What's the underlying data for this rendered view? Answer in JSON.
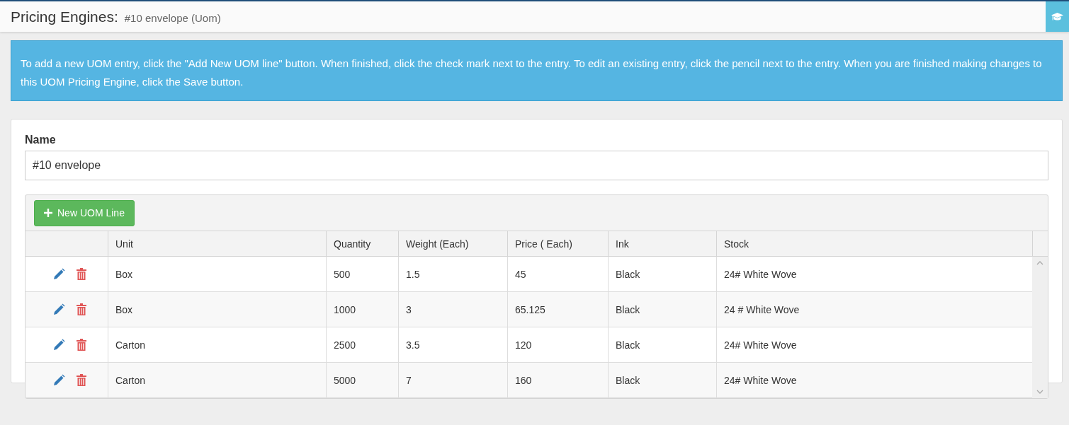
{
  "header": {
    "title": "Pricing Engines:",
    "subtitle": "#10 envelope (Uom)"
  },
  "info": "To add a new UOM entry, click the \"Add New UOM line\" button. When finished, click the check mark next to the entry. To edit an existing entry, click the pencil next to the entry. When you are finished making changes to this UOM Pricing Engine, click the Save button.",
  "form": {
    "name_label": "Name",
    "name_value": "#10 envelope"
  },
  "toolbar": {
    "add_button": "New UOM Line"
  },
  "table": {
    "columns": [
      "Unit",
      "Quantity",
      "Weight (Each)",
      "Price ( Each)",
      "Ink",
      "Stock"
    ],
    "rows": [
      {
        "cells": [
          "Box",
          "500",
          "1.5",
          "45",
          "Black",
          "24# White Wove"
        ]
      },
      {
        "cells": [
          "Box",
          "1000",
          "3",
          "65.125",
          "Black",
          "24 # White Wove"
        ]
      },
      {
        "cells": [
          "Carton",
          "2500",
          "3.5",
          "120",
          "Black",
          "24# White Wove"
        ]
      },
      {
        "cells": [
          "Carton",
          "5000",
          "7",
          "160",
          "Black",
          "24# White Wove"
        ]
      }
    ]
  }
}
